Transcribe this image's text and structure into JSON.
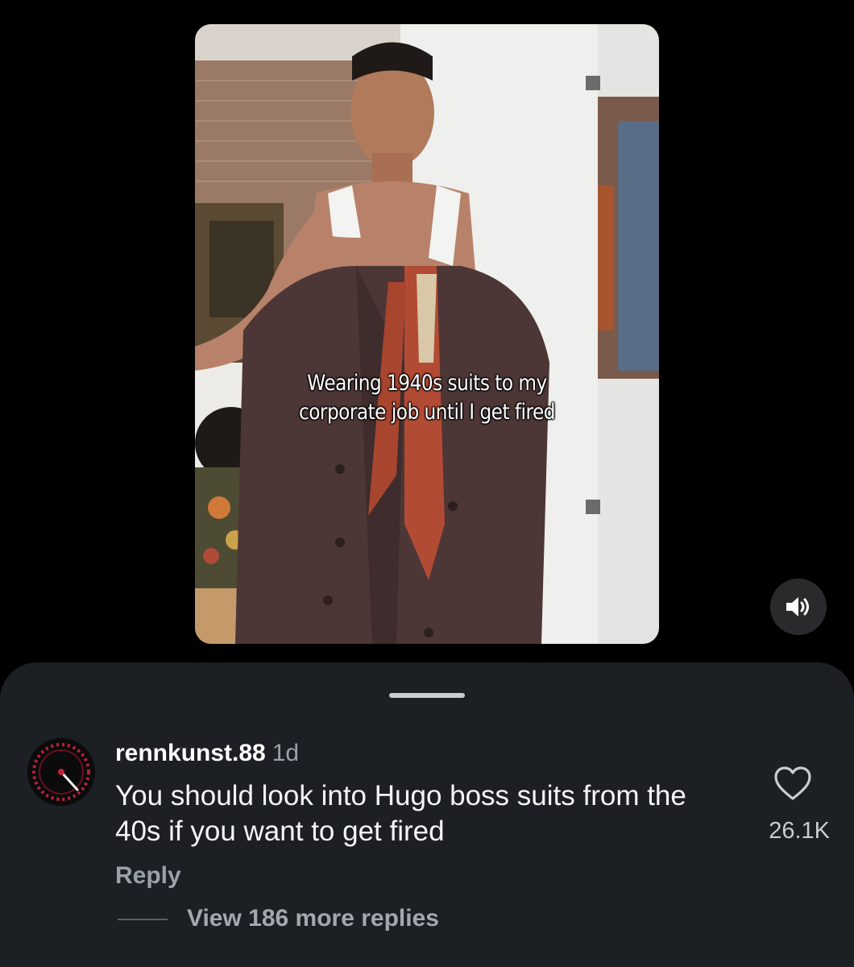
{
  "video": {
    "caption_line1": "Wearing 1940s suits to my",
    "caption_line2": "corporate job until I get fired",
    "sound_icon": "speaker-icon"
  },
  "comment": {
    "username": "rennkunst.88",
    "time": "1d",
    "text": "You should look into Hugo boss suits from the 40s if you want to get fired",
    "like_count": "26.1K",
    "reply_label": "Reply",
    "view_replies_label": "View 186 more replies",
    "icons": {
      "like": "heart-icon",
      "avatar": "speedometer-avatar"
    }
  },
  "colors": {
    "sheet_bg": "#1c1f24",
    "text_primary": "#f4f5f7",
    "text_secondary": "#9ba1ab"
  }
}
